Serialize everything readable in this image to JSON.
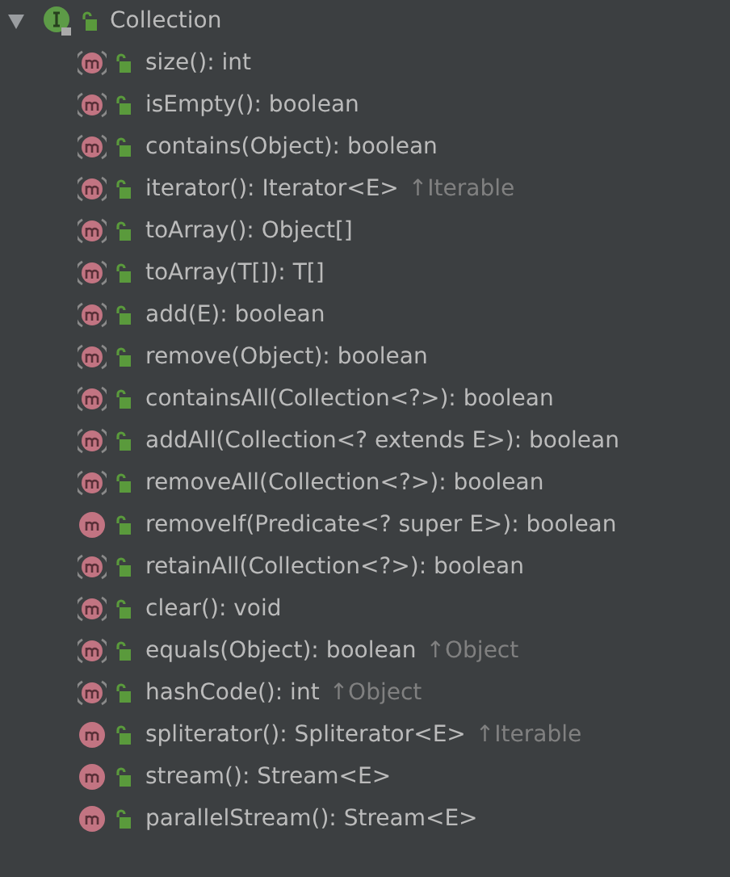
{
  "root": {
    "label": "Collection",
    "expanded": true,
    "kind": "interface",
    "children": [
      {
        "kind": "abstract",
        "label": "size(): int"
      },
      {
        "kind": "abstract",
        "label": "isEmpty(): boolean"
      },
      {
        "kind": "abstract",
        "label": "contains(Object): boolean"
      },
      {
        "kind": "abstract",
        "label": "iterator(): Iterator<E>",
        "inherited_from": "↑Iterable"
      },
      {
        "kind": "abstract",
        "label": "toArray(): Object[]"
      },
      {
        "kind": "abstract",
        "label": "toArray(T[]): T[]"
      },
      {
        "kind": "abstract",
        "label": "add(E): boolean"
      },
      {
        "kind": "abstract",
        "label": "remove(Object): boolean"
      },
      {
        "kind": "abstract",
        "label": "containsAll(Collection<?>): boolean"
      },
      {
        "kind": "abstract",
        "label": "addAll(Collection<? extends E>): boolean"
      },
      {
        "kind": "abstract",
        "label": "removeAll(Collection<?>): boolean"
      },
      {
        "kind": "default",
        "label": "removeIf(Predicate<? super E>): boolean"
      },
      {
        "kind": "abstract",
        "label": "retainAll(Collection<?>): boolean"
      },
      {
        "kind": "abstract",
        "label": "clear(): void"
      },
      {
        "kind": "abstract",
        "label": "equals(Object): boolean",
        "inherited_from": "↑Object"
      },
      {
        "kind": "abstract",
        "label": "hashCode(): int",
        "inherited_from": "↑Object"
      },
      {
        "kind": "default",
        "label": "spliterator(): Spliterator<E>",
        "inherited_from": "↑Iterable"
      },
      {
        "kind": "default",
        "label": "stream(): Stream<E>"
      },
      {
        "kind": "default",
        "label": "parallelStream(): Stream<E>"
      }
    ]
  }
}
